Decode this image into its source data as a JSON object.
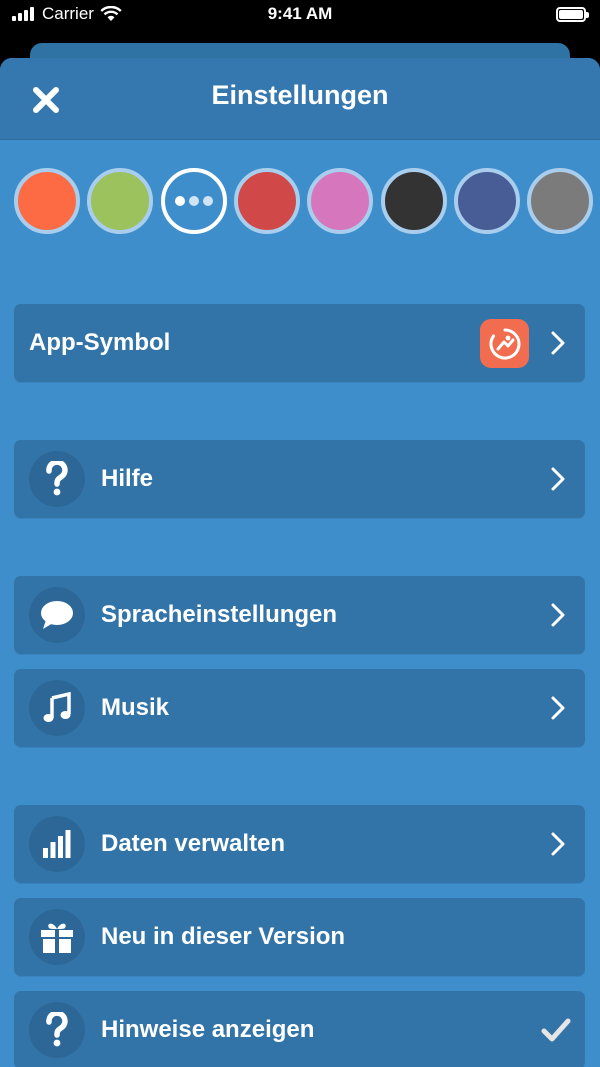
{
  "status_bar": {
    "carrier": "Carrier",
    "time": "9:41 AM"
  },
  "header": {
    "title": "Einstellungen",
    "close_icon": "close-icon"
  },
  "colors": {
    "swatches": [
      "#fd6b45",
      "#9bc25d",
      "selected",
      "#d14849",
      "#d677be",
      "#333333",
      "#485c95",
      "#7b7b7b"
    ],
    "background": "#3e8ecc",
    "row": "#3374a8"
  },
  "settings": {
    "app_icon": {
      "label": "App-Symbol",
      "icon": "app-icon-thumbnail"
    },
    "help": {
      "label": "Hilfe",
      "icon": "question-icon"
    },
    "speech": {
      "label": "Spracheinstellungen",
      "icon": "speech-bubble-icon"
    },
    "music": {
      "label": "Musik",
      "icon": "music-note-icon"
    },
    "data": {
      "label": "Daten verwalten",
      "icon": "bar-chart-icon"
    },
    "whats_new": {
      "label": "Neu in dieser Version",
      "icon": "gift-icon"
    },
    "hints": {
      "label": "Hinweise anzeigen",
      "icon": "question-icon",
      "checked": true
    }
  }
}
